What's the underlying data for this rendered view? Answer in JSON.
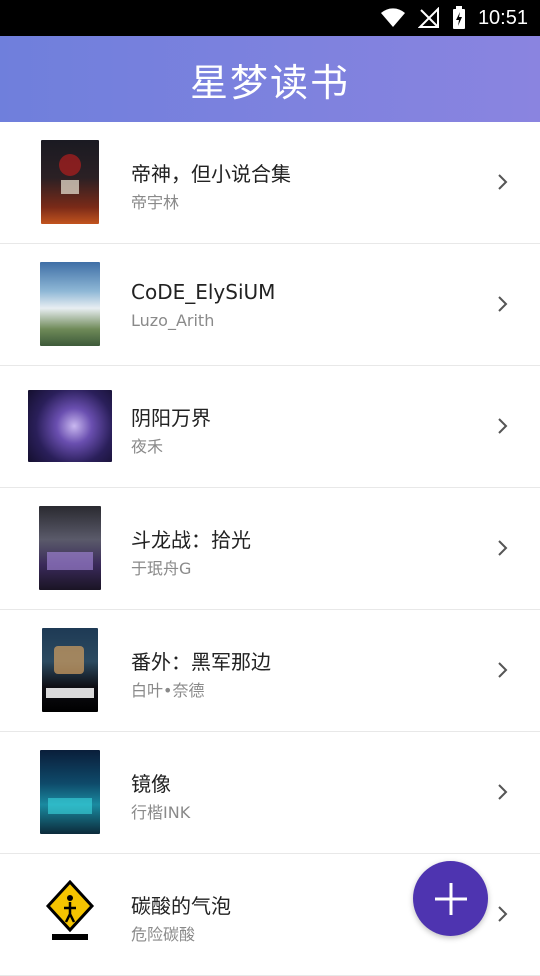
{
  "status_bar": {
    "time": "10:51"
  },
  "header": {
    "title": "星梦读书"
  },
  "books": [
    {
      "title": "帝神，但小说合集",
      "author": "帝宇林"
    },
    {
      "title": "CoDE_ElySiUM",
      "author": "Luzo_Arith"
    },
    {
      "title": "阴阳万界",
      "author": "夜禾"
    },
    {
      "title": "斗龙战：拾光",
      "author": "于珉舟G"
    },
    {
      "title": "番外：黑军那边",
      "author": "白叶•奈德"
    },
    {
      "title": "镜像",
      "author": "行楷INK"
    },
    {
      "title": "碳酸的气泡",
      "author": "危险碳酸"
    }
  ],
  "icons": {
    "wifi": "wifi-icon",
    "signal": "no-signal-icon",
    "battery": "battery-charging-icon",
    "chevron": "chevron-right-icon",
    "fab": "plus-icon"
  },
  "colors": {
    "header_start": "#6f7fdc",
    "header_end": "#8a84e0",
    "fab": "#4e34b0"
  }
}
